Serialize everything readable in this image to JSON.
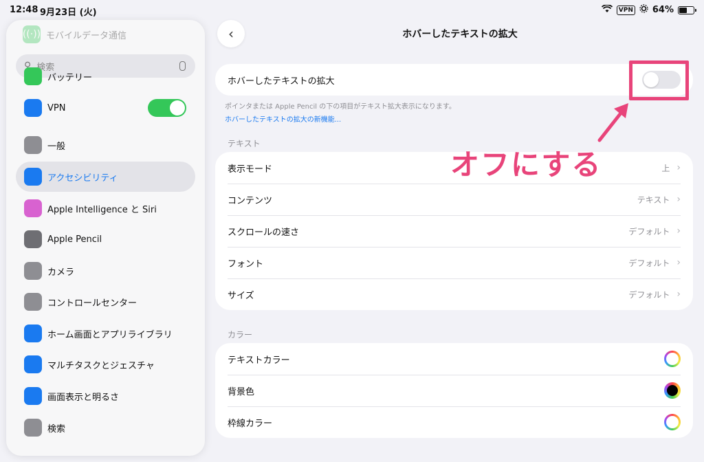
{
  "status": {
    "time": "12:48",
    "date": "9月23日 (火)",
    "vpn": "VPN",
    "battery_pct": "64%",
    "battery_level": 0.64
  },
  "sidebar": {
    "faded_item": "モバイルデータ通信",
    "search_placeholder": "検索",
    "items": [
      {
        "label": "バッテリー",
        "icon": "battery-icon",
        "color": "#34c759"
      },
      {
        "label": "VPN",
        "icon": "globe-icon",
        "color": "#1a7af0",
        "toggle_on": true
      },
      {
        "label": "一般",
        "icon": "gear-icon",
        "color": "#8e8e93"
      },
      {
        "label": "アクセシビリティ",
        "icon": "accessibility-icon",
        "color": "#1a7af0",
        "active": true
      },
      {
        "label": "Apple Intelligence と Siri",
        "icon": "apple-intelligence-icon",
        "color": "#d862d0"
      },
      {
        "label": "Apple Pencil",
        "icon": "pencil-icon",
        "color": "#6e6e73"
      },
      {
        "label": "カメラ",
        "icon": "camera-icon",
        "color": "#8e8e93"
      },
      {
        "label": "コントロールセンター",
        "icon": "control-center-icon",
        "color": "#8e8e93"
      },
      {
        "label": "ホーム画面とアプリライブラリ",
        "icon": "home-screen-icon",
        "color": "#1a7af0"
      },
      {
        "label": "マルチタスクとジェスチャ",
        "icon": "multitask-icon",
        "color": "#1a7af0"
      },
      {
        "label": "画面表示と明るさ",
        "icon": "brightness-icon",
        "color": "#1a7af0"
      },
      {
        "label": "検索",
        "icon": "search-icon",
        "color": "#8e8e93"
      }
    ]
  },
  "main": {
    "title": "ホバーしたテキストの拡大",
    "main_toggle_label": "ホバーしたテキストの拡大",
    "main_toggle_on": false,
    "footnote": "ポインタまたは Apple Pencil の下の項目がテキスト拡大表示になります。",
    "link": "ホバーしたテキストの拡大の新機能...",
    "text_section": "テキスト",
    "text_rows": [
      {
        "label": "表示モード",
        "value": "上"
      },
      {
        "label": "コンテンツ",
        "value": "テキスト"
      },
      {
        "label": "スクロールの速さ",
        "value": "デフォルト"
      },
      {
        "label": "フォント",
        "value": "デフォルト"
      },
      {
        "label": "サイズ",
        "value": "デフォルト"
      }
    ],
    "color_section": "カラー",
    "color_rows": [
      {
        "label": "テキストカラー",
        "swatch": "ring"
      },
      {
        "label": "背景色",
        "swatch": "black"
      },
      {
        "label": "枠線カラー",
        "swatch": "ring"
      }
    ]
  },
  "annotation": {
    "text": "オフにする",
    "color": "#e8447a"
  }
}
